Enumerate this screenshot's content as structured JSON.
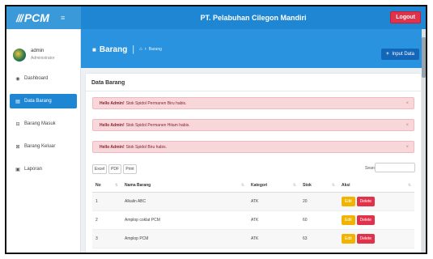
{
  "app": {
    "logo_mark": "///",
    "logo_text": "PCM",
    "title": "PT. Pelabuhan Cilegon Mandiri",
    "logout_label": "Logout"
  },
  "user": {
    "name": "admin",
    "role": "Administrator"
  },
  "sidebar": {
    "items": [
      {
        "label": "Dashboard",
        "icon": "dashboard-icon",
        "active": false
      },
      {
        "label": "Data Barang",
        "icon": "clipboard-icon",
        "active": true
      },
      {
        "label": "Barang Masuk",
        "icon": "cart-icon",
        "active": false
      },
      {
        "label": "Barang Keluar",
        "icon": "cart-out-icon",
        "active": false
      },
      {
        "label": "Laporan",
        "icon": "report-icon",
        "active": false
      }
    ]
  },
  "header": {
    "title": "Barang",
    "breadcrumb": "Barang",
    "input_button": "Input Data"
  },
  "panel": {
    "title": "Data Barang"
  },
  "alerts": [
    {
      "bold": "Hello Admin!",
      "text": "Stok Spidol Permanen Biru habis."
    },
    {
      "bold": "Hello Admin!",
      "text": "Stok Spidol Permanen Hitam habis."
    },
    {
      "bold": "Hello Admin!",
      "text": "Stok Spidol Biru habis."
    }
  ],
  "table_tools": {
    "excel": "Excel",
    "pdf": "PDF",
    "print": "Print",
    "search_label": "Search:",
    "search_value": ""
  },
  "table": {
    "columns": [
      "No",
      "Nama Barang",
      "Kategori",
      "Stok",
      "Aksi"
    ],
    "edit_label": "Edit",
    "delete_label": "Delete",
    "rows": [
      {
        "no": "1",
        "nama": "Alkalin ABC",
        "kategori": "ATK",
        "stok": "20"
      },
      {
        "no": "2",
        "nama": "Amplop coklat PCM",
        "kategori": "ATK",
        "stok": "60"
      },
      {
        "no": "3",
        "nama": "Amplop PCM",
        "kategori": "ATK",
        "stok": "63"
      }
    ]
  },
  "colors": {
    "primary": "#1f86d3",
    "header_band": "#2a93df",
    "logout": "#e0324a",
    "edit": "#f0b400",
    "delete": "#e0324a",
    "alert_bg": "#f8d7da"
  }
}
